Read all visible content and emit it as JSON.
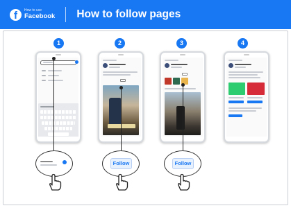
{
  "header": {
    "logo_small": "How to use",
    "logo_brand": "Facebook",
    "logo_glyph": "f",
    "title": "How to follow pages",
    "bg_color": "#1877f2"
  },
  "steps": [
    {
      "number": "1"
    },
    {
      "number": "2"
    },
    {
      "number": "3"
    },
    {
      "number": "4"
    }
  ],
  "bubbles": [
    {
      "label": ""
    },
    {
      "label": "Follow"
    },
    {
      "label": "Follow"
    }
  ]
}
